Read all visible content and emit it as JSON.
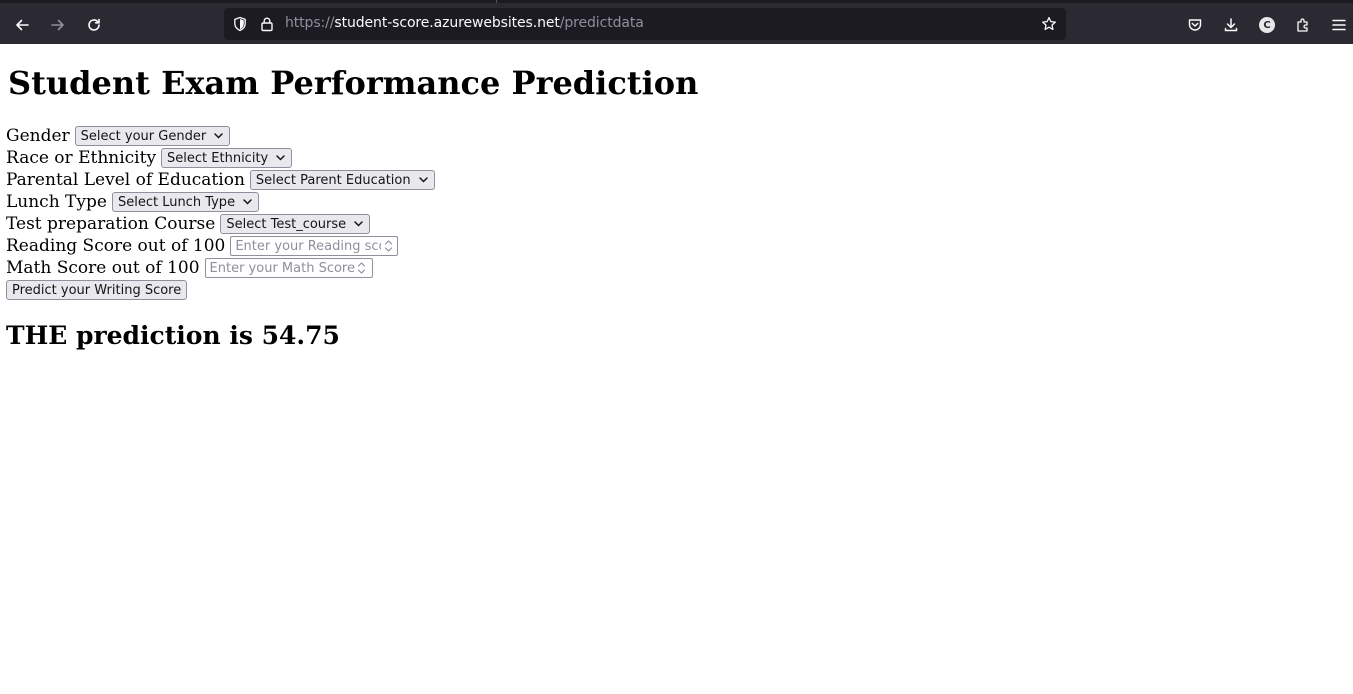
{
  "browser": {
    "url_scheme": "https://",
    "url_host": "student-score.azurewebsites.net",
    "url_path": "/predictdata",
    "account_initial": "C",
    "icons": [
      "back-icon",
      "forward-icon",
      "reload-icon",
      "shield-icon",
      "lock-icon",
      "bookmark-star-icon",
      "pocket-icon",
      "download-icon",
      "account-icon",
      "extensions-icon",
      "menu-icon"
    ]
  },
  "page": {
    "title": "Student Exam Performance Prediction",
    "form": {
      "gender_label": "Gender",
      "gender_value": "Select your Gender",
      "ethnicity_label": "Race or Ethnicity",
      "ethnicity_value": "Select Ethnicity",
      "parent_edu_label": "Parental Level of Education",
      "parent_edu_value": "Select Parent Education",
      "lunch_label": "Lunch Type",
      "lunch_value": "Select Lunch Type",
      "test_prep_label": "Test preparation Course",
      "test_prep_value": "Select Test_course",
      "reading_label": "Reading Score out of 100",
      "reading_placeholder": "Enter your Reading score",
      "math_label": "Math Score out of 100",
      "math_placeholder": "Enter your Math Score",
      "submit_label": "Predict your Writing Score"
    },
    "result": "THE prediction is 54.75"
  }
}
